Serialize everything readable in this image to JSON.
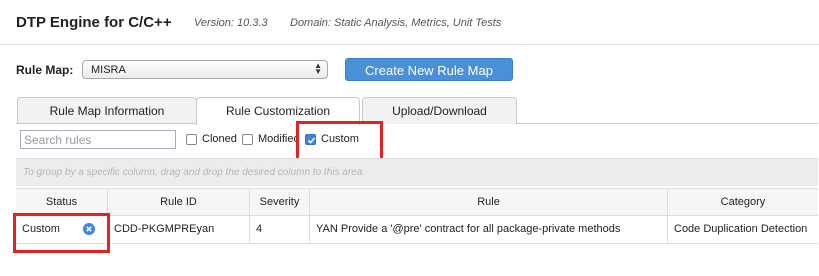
{
  "header": {
    "title": "DTP Engine for C/C++",
    "version": "Version: 10.3.3",
    "domain": "Domain: Static Analysis, Metrics, Unit Tests"
  },
  "rule_map": {
    "label": "Rule Map:",
    "selected": "MISRA",
    "create_button": "Create New Rule Map"
  },
  "tabs": [
    {
      "label": "Rule Map Information",
      "active": false
    },
    {
      "label": "Rule Customization",
      "active": true
    },
    {
      "label": "Upload/Download",
      "active": false
    }
  ],
  "filters": {
    "search_placeholder": "Search rules",
    "cloned": {
      "label": "Cloned",
      "checked": false
    },
    "modified": {
      "label": "Modified",
      "checked": false
    },
    "custom": {
      "label": "Custom",
      "checked": true
    }
  },
  "group_hint": "To group by a specific column, drag and drop the desired column to this area.",
  "table": {
    "columns": [
      "Status",
      "Rule ID",
      "Severity",
      "Rule",
      "Category"
    ],
    "rows": [
      {
        "status": "Custom",
        "rule_id": "CDD-PKGMPREyan",
        "severity": "4",
        "rule": "YAN Provide a '@pre' contract for all package-private methods",
        "category": "Code Duplication Detection"
      }
    ]
  },
  "colors": {
    "accent": "#4a90d9",
    "highlight": "#e52222",
    "checkbox_checked": "#3a86e0"
  },
  "icons": {
    "remove_status": "circle-x-icon",
    "select_arrows": "up-down-arrows-icon",
    "checkmark": "check-icon"
  }
}
